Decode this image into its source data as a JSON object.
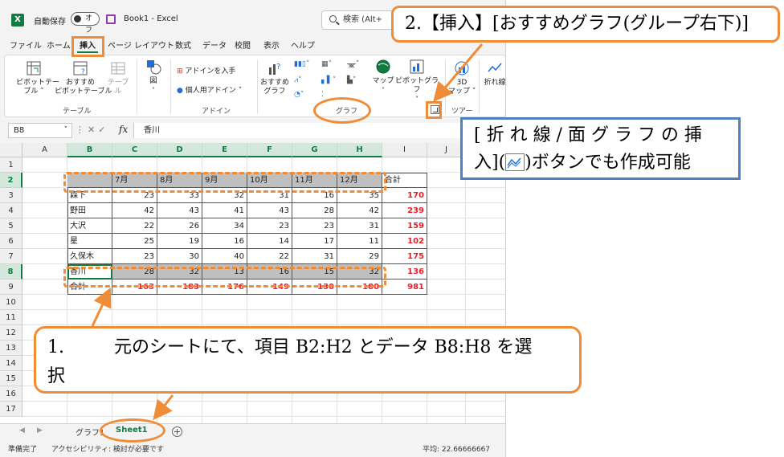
{
  "app": {
    "autosave_label": "自動保存",
    "autosave_state": "オフ",
    "document_title": "Book1  -  Excel",
    "search_placeholder": "検索 (Alt+"
  },
  "menu_tabs": [
    "ファイル",
    "ホーム",
    "挿入",
    "ページ レイアウト",
    "数式",
    "データ",
    "校閲",
    "表示",
    "ヘルプ"
  ],
  "active_tab": "挿入",
  "ribbon": {
    "table_group": {
      "label": "テーブル",
      "pivot_table": "ピボットテー\nブル ˅",
      "recommended_pivot": "おすすめ\nピボットテーブル",
      "table": "テーブル"
    },
    "illustrations": {
      "label": "図"
    },
    "addins_group": {
      "label": "アドイン",
      "get_addins": "アドインを入手",
      "my_addins": "個人用アドイン ˅"
    },
    "chart_group": {
      "label": "グラフ",
      "recommended_charts": "おすすめ\nグラフ",
      "maps": "マップ",
      "pivot_chart": "ピボットグラフ"
    },
    "tour_group": {
      "label": "ツアー",
      "map_3d": "3D\nマップ ˅"
    },
    "sparkline": {
      "line": "折れ線"
    }
  },
  "formula_bar": {
    "name_box": "B8",
    "fx": "fx",
    "content": "香川"
  },
  "grid": {
    "columns": [
      "A",
      "B",
      "C",
      "D",
      "E",
      "F",
      "G",
      "H",
      "I",
      "J"
    ],
    "rows": [
      "1",
      "2",
      "3",
      "4",
      "5",
      "6",
      "7",
      "8",
      "9",
      "10",
      "11",
      "12",
      "13",
      "14",
      "15",
      "16",
      "17"
    ],
    "header_row": [
      "",
      "7月",
      "8月",
      "9月",
      "10月",
      "11月",
      "12月",
      "合計"
    ],
    "data_rows": [
      {
        "name": "森下",
        "values": [
          23,
          33,
          32,
          31,
          16,
          35
        ],
        "total": 170
      },
      {
        "name": "野田",
        "values": [
          42,
          43,
          41,
          43,
          28,
          42
        ],
        "total": 239
      },
      {
        "name": "大沢",
        "values": [
          22,
          26,
          34,
          23,
          23,
          31
        ],
        "total": 159
      },
      {
        "name": "星",
        "values": [
          25,
          19,
          16,
          14,
          17,
          11
        ],
        "total": 102
      },
      {
        "name": "久保木",
        "values": [
          23,
          30,
          40,
          22,
          31,
          29
        ],
        "total": 175
      },
      {
        "name": "香川",
        "values": [
          28,
          32,
          13,
          16,
          15,
          32
        ],
        "total": 136
      }
    ],
    "total_row": {
      "name": "合計",
      "values": [
        163,
        183,
        176,
        149,
        130,
        180
      ],
      "total": 981
    }
  },
  "sheet_tabs": [
    "グラフ1",
    "Sheet1"
  ],
  "active_sheet": "Sheet1",
  "status": {
    "ready": "準備完了",
    "accessibility": "アクセシビリティ: 検討が必要です",
    "average": "平均: 22.66666667"
  },
  "annotations": {
    "step1_number": "1.",
    "step1_text": "元のシートにて、項目 B2:H2 とデータ B8:H8 を選",
    "step1_text2": "択",
    "step2_text": "2.【挿入】[おすすめグラフ(グループ右下)]",
    "note_line1": "[ 折 れ 線 / 面 グ ラ フ の 挿",
    "note_line2_pre": "入](",
    "note_line2_post": ")ボタンでも作成可能"
  },
  "colors": {
    "excel_green": "#107c41",
    "annotation_orange": "#f08c37",
    "annotation_blue": "#4f81bd",
    "total_red": "#e8202a",
    "selection_gray": "#bfbfbf"
  }
}
